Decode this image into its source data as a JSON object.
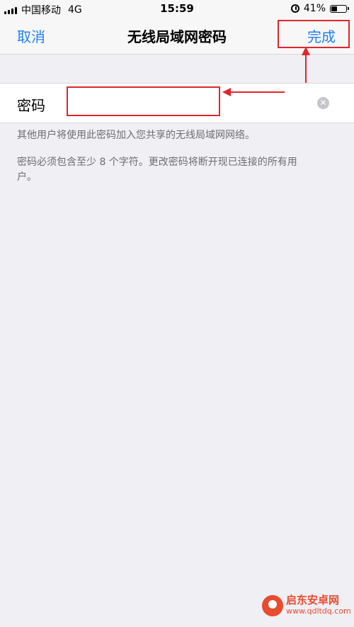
{
  "status_bar": {
    "carrier": "中国移动",
    "network": "4G",
    "time": "15:59",
    "battery": "41%",
    "battery_level": 0.41
  },
  "nav": {
    "cancel_label": "取消",
    "title": "无线局域网密码",
    "done_label": "完成",
    "link_color": "#1f7ff3"
  },
  "form": {
    "password_label": "密码",
    "password_value": "",
    "clear_icon": "clear-circle-icon"
  },
  "notes": {
    "line1": "其他用户将使用此密码加入您共享的无线局域网网络。",
    "line2": "密码必须包含至少 8 个字符。更改密码将断开现已连接的所有用户。"
  },
  "annotation_color": "#e0262d",
  "watermark": {
    "name": "启东安卓网",
    "url": "www.qdltdq.com"
  }
}
